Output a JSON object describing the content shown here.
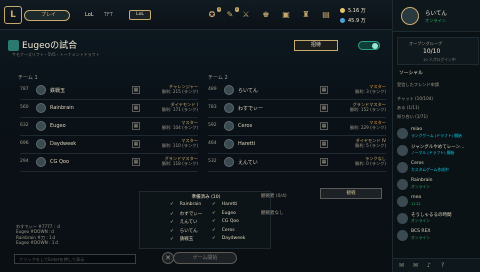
{
  "topbar": {
    "play_label": "プレイ",
    "nav": [
      "LoL",
      "TFT"
    ],
    "badge": "LoL",
    "icon_counts": [
      "3",
      "1"
    ],
    "blue_essence": "5.16 万",
    "riot_points": "45.9 万"
  },
  "lobby": {
    "title": "Eugeoの試合",
    "subtitle": "サモナーズリフト・5V5・トーナメントドラフト",
    "invite_label": "招待",
    "team1_label": "チーム 1",
    "team2_label": "チーム 2",
    "team1": [
      {
        "level": "787",
        "name": "鉄戦玉",
        "rank1": "チャレンジャー",
        "rank2": "勝利: 215 (ランク)"
      },
      {
        "level": "560",
        "name": "Rainbrain",
        "rank1": "ダイヤモンド I",
        "rank2": "勝利: 171 (ランク)"
      },
      {
        "level": "632",
        "name": "Eugeo",
        "rank1": "マスター",
        "rank2": "勝利: 104 (ランク)"
      },
      {
        "level": "696",
        "name": "Daydweek",
        "rank1": "マスター",
        "rank2": "勝利: 110 (ランク)"
      },
      {
        "level": "294",
        "name": "CG Qoo",
        "rank1": "グランドマスター",
        "rank2": "勝利: 118 (ランク)"
      }
    ],
    "team2": [
      {
        "level": "489",
        "name": "らいてん",
        "rank1": "マスター",
        "rank2": "勝利: 3 (ランク)"
      },
      {
        "level": "783",
        "name": "わすでぃー",
        "rank1": "グランドマスター",
        "rank2": "勝利: 152 (ランク)"
      },
      {
        "level": "592",
        "name": "Ceros",
        "rank1": "マスター",
        "rank2": "勝利: 229 (ランク)"
      },
      {
        "level": "464",
        "name": "Haretti",
        "rank1": "ダイヤモンド IV",
        "rank2": "勝利: 5 (ランク)"
      },
      {
        "level": "532",
        "name": "えんてい",
        "rank1": "ランクなし",
        "rank2": "勝利: 0 (ランク)"
      }
    ]
  },
  "checklist": {
    "title": "準備済み (10)",
    "left": [
      "Rainbrain",
      "わすでぃー",
      "えんてい",
      "らいてん",
      "鉄戦玉"
    ],
    "right": [
      "Haretti",
      "Eugeo",
      "CG Qoo",
      "Ceros",
      "Daydweek"
    ]
  },
  "spectators": {
    "label": "観戦者 (0/4)",
    "empty": "観戦者なし",
    "button": "観戦"
  },
  "chat": {
    "lines": [
      "わすでぃー #7777 : ｄ",
      "Eugeo #DOWN :ｄ",
      "Rainbrain #刀 : 1ｄ",
      "Eugeo #DOWN : 1ｄ"
    ],
    "placeholder": "クリックをしてEnterを押して表示"
  },
  "start_button": "ゲーム開始",
  "sidebar": {
    "me_name": "らいてん",
    "me_status": "オンライン",
    "group_label": "オープングループ",
    "group_count": "10/10",
    "group_sub": "10 人がログイン中",
    "social_label": "ソーシャル",
    "requests": "受信したフレンド申請",
    "chat_section": "チャット (10/104)",
    "fav_section": "ある (1/11)",
    "recent_section": "知り合い (1/71)",
    "friends": [
      {
        "name": "miao",
        "status": "ランクゲーム (ドラフト) 開始"
      },
      {
        "name": "ジャングルやめてレーン...",
        "status": "ノーマル (ドラフト) 開始"
      },
      {
        "name": "Ceros",
        "status": "カスタムゲーム作成中"
      },
      {
        "name": "Rainbrain",
        "status": "オンライン"
      },
      {
        "name": "rnea",
        "status": "1112"
      },
      {
        "name": "そうしゃるるの時間",
        "status": "オンライン"
      },
      {
        "name": "BCS REX",
        "status": "オンライン"
      }
    ]
  }
}
